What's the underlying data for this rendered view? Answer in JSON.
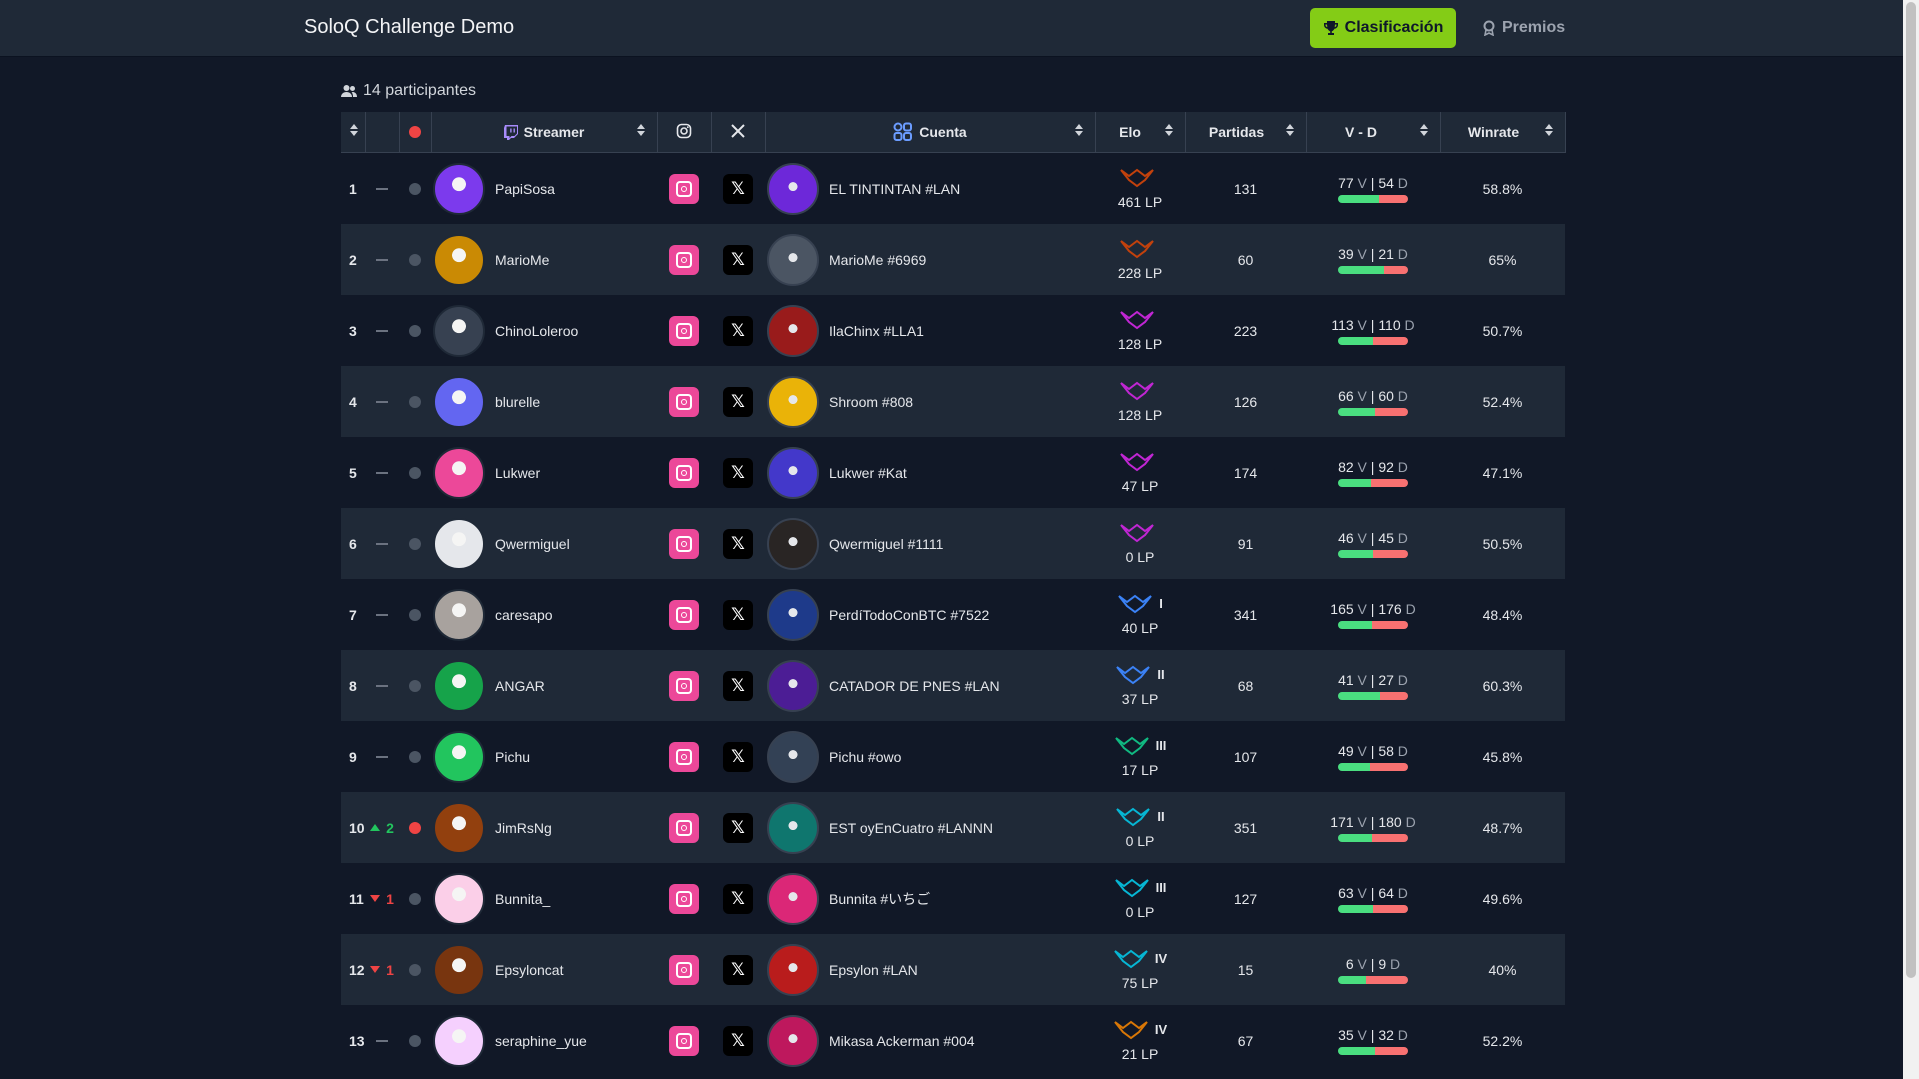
{
  "header": {
    "title": "SoloQ Challenge Demo",
    "nav": {
      "clasificacion": "Clasificación",
      "premios": "Premios"
    },
    "accent": "#84cc16"
  },
  "summary": {
    "participants": "14 participantes"
  },
  "table": {
    "columns": {
      "streamer": "Streamer",
      "cuenta": "Cuenta",
      "elo": "Elo",
      "partidas": "Partidas",
      "vd": "V - D",
      "winrate": "Winrate"
    },
    "rows": [
      {
        "pos": "1",
        "chg": "",
        "live": false,
        "streamer": "PapiSosa",
        "account": "EL TINTINTAN #LAN",
        "tier": "",
        "division": "",
        "lp": "461 LP",
        "games": "131",
        "wins": "77",
        "losses": "54",
        "win_frac": 0.588,
        "winrate": "58.8%",
        "emblem_color": "#c2410c",
        "avatar_color": "#7c3aed",
        "acc_color": "#6d28d9"
      },
      {
        "pos": "2",
        "chg": "",
        "live": false,
        "streamer": "MarioMe",
        "account": "MarioMe #6969",
        "tier": "",
        "division": "",
        "lp": "228 LP",
        "games": "60",
        "wins": "39",
        "losses": "21",
        "win_frac": 0.65,
        "winrate": "65%",
        "emblem_color": "#c2410c",
        "avatar_color": "#ca8a04",
        "acc_color": "#4b5563"
      },
      {
        "pos": "3",
        "chg": "",
        "live": false,
        "streamer": "ChinoLoleroo",
        "account": "IlaChinx #LLA1",
        "tier": "",
        "division": "",
        "lp": "128 LP",
        "games": "223",
        "wins": "113",
        "losses": "110",
        "win_frac": 0.507,
        "winrate": "50.7%",
        "emblem_color": "#c026d3",
        "avatar_color": "#374151",
        "acc_color": "#991b1b"
      },
      {
        "pos": "4",
        "chg": "",
        "live": false,
        "streamer": "blurelle",
        "account": "Shroom #808",
        "tier": "",
        "division": "",
        "lp": "128 LP",
        "games": "126",
        "wins": "66",
        "losses": "60",
        "win_frac": 0.524,
        "winrate": "52.4%",
        "emblem_color": "#c026d3",
        "avatar_color": "#6366f1",
        "acc_color": "#eab308"
      },
      {
        "pos": "5",
        "chg": "",
        "live": false,
        "streamer": "Lukwer",
        "account": "Lukwer #Kat",
        "tier": "",
        "division": "",
        "lp": "47 LP",
        "games": "174",
        "wins": "82",
        "losses": "92",
        "win_frac": 0.471,
        "winrate": "47.1%",
        "emblem_color": "#c026d3",
        "avatar_color": "#ec4899",
        "acc_color": "#4338ca"
      },
      {
        "pos": "6",
        "chg": "",
        "live": false,
        "streamer": "Qwermiguel",
        "account": "Qwermiguel #1111",
        "tier": "",
        "division": "",
        "lp": "0 LP",
        "games": "91",
        "wins": "46",
        "losses": "45",
        "win_frac": 0.505,
        "winrate": "50.5%",
        "emblem_color": "#c026d3",
        "avatar_color": "#e5e7eb",
        "acc_color": "#292524"
      },
      {
        "pos": "7",
        "chg": "",
        "live": false,
        "streamer": "caresapo",
        "account": "PerdíTodoConBTC #7522",
        "tier": "",
        "division": "I",
        "lp": "40 LP",
        "games": "341",
        "wins": "165",
        "losses": "176",
        "win_frac": 0.484,
        "winrate": "48.4%",
        "emblem_color": "#3b82f6",
        "avatar_color": "#a8a29e",
        "acc_color": "#1e3a8a"
      },
      {
        "pos": "8",
        "chg": "",
        "live": false,
        "streamer": "ANGAR",
        "account": "CATADOR DE PNES #LAN",
        "tier": "",
        "division": "II",
        "lp": "37 LP",
        "games": "68",
        "wins": "41",
        "losses": "27",
        "win_frac": 0.603,
        "winrate": "60.3%",
        "emblem_color": "#3b82f6",
        "avatar_color": "#16a34a",
        "acc_color": "#4c1d95"
      },
      {
        "pos": "9",
        "chg": "",
        "live": false,
        "streamer": "Pichu",
        "account": "Pichu #owo",
        "tier": "",
        "division": "III",
        "lp": "17 LP",
        "games": "107",
        "wins": "49",
        "losses": "58",
        "win_frac": 0.458,
        "winrate": "45.8%",
        "emblem_color": "#10b981",
        "avatar_color": "#22c55e",
        "acc_color": "#334155"
      },
      {
        "pos": "10",
        "chg": "2",
        "dir": "up",
        "live": true,
        "streamer": "JimRsNg",
        "account": "EST oyEnCuatro #LANNN",
        "tier": "",
        "division": "II",
        "lp": "0 LP",
        "games": "351",
        "wins": "171",
        "losses": "180",
        "win_frac": 0.487,
        "winrate": "48.7%",
        "emblem_color": "#06b6d4",
        "avatar_color": "#92400e",
        "acc_color": "#0f766e"
      },
      {
        "pos": "11",
        "chg": "1",
        "dir": "down",
        "live": false,
        "streamer": "Bunnita_",
        "account": "Bunnita #いちご",
        "tier": "",
        "division": "III",
        "lp": "0 LP",
        "games": "127",
        "wins": "63",
        "losses": "64",
        "win_frac": 0.496,
        "winrate": "49.6%",
        "emblem_color": "#06b6d4",
        "avatar_color": "#fbcfe8",
        "acc_color": "#db2777"
      },
      {
        "pos": "12",
        "chg": "1",
        "dir": "down",
        "live": false,
        "streamer": "Epsyloncat",
        "account": "Epsylon #LAN",
        "tier": "",
        "division": "IV",
        "lp": "75 LP",
        "games": "15",
        "wins": "6",
        "losses": "9",
        "win_frac": 0.4,
        "winrate": "40%",
        "emblem_color": "#06b6d4",
        "avatar_color": "#78350f",
        "acc_color": "#b91c1c"
      },
      {
        "pos": "13",
        "chg": "",
        "live": false,
        "streamer": "seraphine_yue",
        "account": "Mikasa Ackerman #004",
        "tier": "",
        "division": "IV",
        "lp": "21 LP",
        "games": "67",
        "wins": "35",
        "losses": "32",
        "win_frac": 0.522,
        "winrate": "52.2%",
        "emblem_color": "#d97706",
        "avatar_color": "#f5d0fe",
        "acc_color": "#be185d"
      }
    ]
  }
}
